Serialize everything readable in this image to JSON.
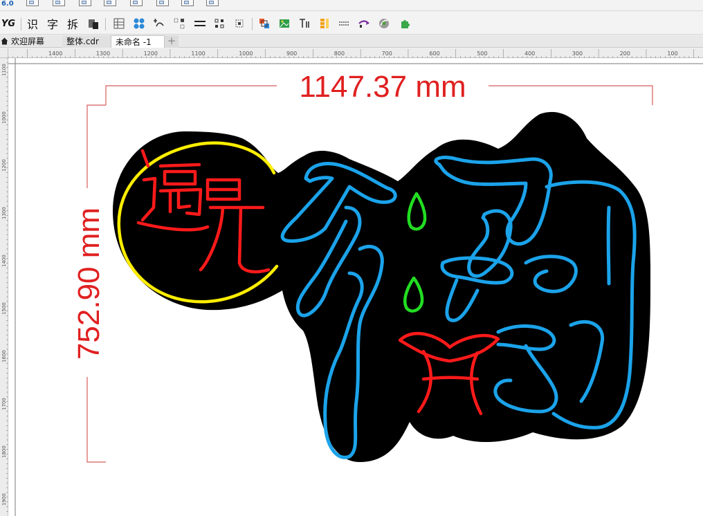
{
  "app": {
    "version_label": "6.0",
    "top_toolbar_icons": [
      "zoom-object-icon",
      "group-icon",
      "ruler-icon",
      "text-frame-icon",
      "arrange-icon",
      "copy-icon",
      "panel-icon"
    ]
  },
  "toolbar": {
    "brand": "YG",
    "buttons": [
      {
        "name": "recognize-button",
        "label": "识"
      },
      {
        "name": "char-button",
        "label": "字"
      },
      {
        "name": "split-button",
        "label": "拆"
      }
    ],
    "icons": [
      "paste-icon",
      "table-icon",
      "pattern-icon",
      "node-curve-icon",
      "dotted-grid-icon",
      "equal-lines-icon",
      "corner-nodes-icon",
      "scatter-nodes-icon",
      "color-align-icon",
      "image-frame-icon",
      "text-column-icon",
      "stack-bars-icon",
      "dot-grid-icon",
      "convert-arrow-icon",
      "ball-gear-icon",
      "puzzle-icon"
    ]
  },
  "tabs": [
    {
      "label": "欢迎屏幕",
      "icon": "home-icon"
    },
    {
      "label": "整体.cdr"
    },
    {
      "label": "未命名 -1",
      "active": true
    },
    {
      "label": "+"
    }
  ],
  "ruler": {
    "h_labels": [
      "1400",
      "1300",
      "1200",
      "1100",
      "1000",
      "900",
      "800",
      "700",
      "600",
      "500",
      "400",
      "300",
      "200",
      "100"
    ],
    "v_labels": [
      "1100",
      "1000",
      "1200",
      "1300",
      "1400",
      "1500",
      "1600",
      "1700",
      "1800",
      "1900"
    ]
  },
  "dimensions": {
    "width_text": "1147.37 mm",
    "height_text": "752.90 mm",
    "line_color": "#d85a5a",
    "text_color": "#e02020"
  },
  "design": {
    "board_color": "#000000",
    "ring_color": "#ffee00",
    "small_text_color": "#ff1a1a",
    "big_text_color": "#1ba3ea",
    "accent_color": "#22dd22",
    "bottom_color": "#ff1a1a"
  }
}
